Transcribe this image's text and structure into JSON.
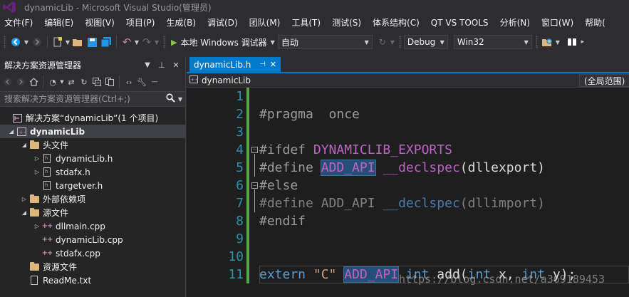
{
  "window": {
    "title": "dynamicLib - Microsoft Visual Studio(管理员)"
  },
  "menu": [
    "文件(F)",
    "编辑(E)",
    "视图(V)",
    "项目(P)",
    "生成(B)",
    "调试(D)",
    "团队(M)",
    "工具(T)",
    "测试(S)",
    "体系结构(C)",
    "QT VS TOOLS",
    "分析(N)",
    "窗口(W)",
    "帮助("
  ],
  "toolbar": {
    "run_label": "本地 Windows 调试器",
    "mode_value": "自动",
    "config_value": "Debug",
    "platform_value": "Win32"
  },
  "solution_explorer": {
    "title": "解决方案资源管理器",
    "search_placeholder": "搜索解决方案资源管理器(Ctrl+;)",
    "items": [
      {
        "label": "解决方案“dynamicLib”(1 个项目)"
      },
      {
        "label": "dynamicLib"
      },
      {
        "label": "头文件"
      },
      {
        "label": "dynamicLib.h"
      },
      {
        "label": "stdafx.h"
      },
      {
        "label": "targetver.h"
      },
      {
        "label": "外部依赖项"
      },
      {
        "label": "源文件"
      },
      {
        "label": "dllmain.cpp"
      },
      {
        "label": "dynamicLib.cpp"
      },
      {
        "label": "stdafx.cpp"
      },
      {
        "label": "资源文件"
      },
      {
        "label": "ReadMe.txt"
      }
    ]
  },
  "editor": {
    "tab_label": "dynamicLib.h",
    "nav_project": "dynamicLib",
    "nav_scope": "(全局范围)",
    "line_numbers": [
      "1",
      "2",
      "3",
      "4",
      "5",
      "6",
      "7",
      "8",
      "9",
      "10",
      "11"
    ],
    "code": {
      "l2_a": "#pragma",
      "l2_b": "once",
      "l4_a": "#ifdef",
      "l4_b": "DYNAMICLIB_EXPORTS",
      "l5_a": "#define",
      "l5_b": "ADD_API",
      "l5_c": "__declspec",
      "l5_d": "(dllexport)",
      "l6_a": "#else",
      "l7_a": "#define ADD_API",
      "l7_b": "__declspec",
      "l7_c": "(dllimport)",
      "l8_a": "#endif",
      "l11_a": "extern",
      "l11_b": "\"C\"",
      "l11_c": "ADD_API",
      "l11_d": "int",
      "l11_e": "add(",
      "l11_f": "int",
      "l11_g": " x, ",
      "l11_h": "int",
      "l11_i": " y);"
    }
  },
  "watermark": "https://blog.csdn.net/a369189453"
}
